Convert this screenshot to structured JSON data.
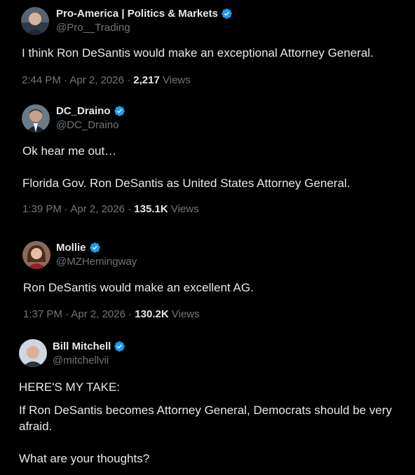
{
  "posts": [
    {
      "name": "Pro-America | Politics & Markets",
      "handle": "@Pro__Trading",
      "text": "I think Ron DeSantis would make an exceptional Attorney General.",
      "time": "2:44 PM",
      "date": "Apr 2, 2026",
      "views": "2,217",
      "views_label": "Views"
    },
    {
      "name": "DC_Draino",
      "handle": "@DC_Draino",
      "text": "Ok hear me out…\n\nFlorida Gov. Ron DeSantis as United States Attorney General.",
      "time": "1:39 PM",
      "date": "Apr 2, 2026",
      "views": "135.1K",
      "views_label": "Views"
    },
    {
      "name": "Mollie",
      "handle": "@MZHemingway",
      "text": "Ron DeSantis would make an excellent AG.",
      "time": "1:37 PM",
      "date": "Apr 2, 2026",
      "views": "130.2K",
      "views_label": "Views"
    },
    {
      "name": "Bill Mitchell",
      "handle": "@mitchellvii",
      "text": "HERE'S MY TAKE:",
      "text2": "If Ron DeSantis becomes Attorney General, Democrats should be very\nafraid.\n\nWhat are your thoughts?"
    }
  ],
  "colors": {
    "verified": "#1d9bf0",
    "muted": "#71767b",
    "text": "#e7e9ea",
    "background": "#000000"
  },
  "icons": {
    "verified": "verified-badge-icon"
  }
}
